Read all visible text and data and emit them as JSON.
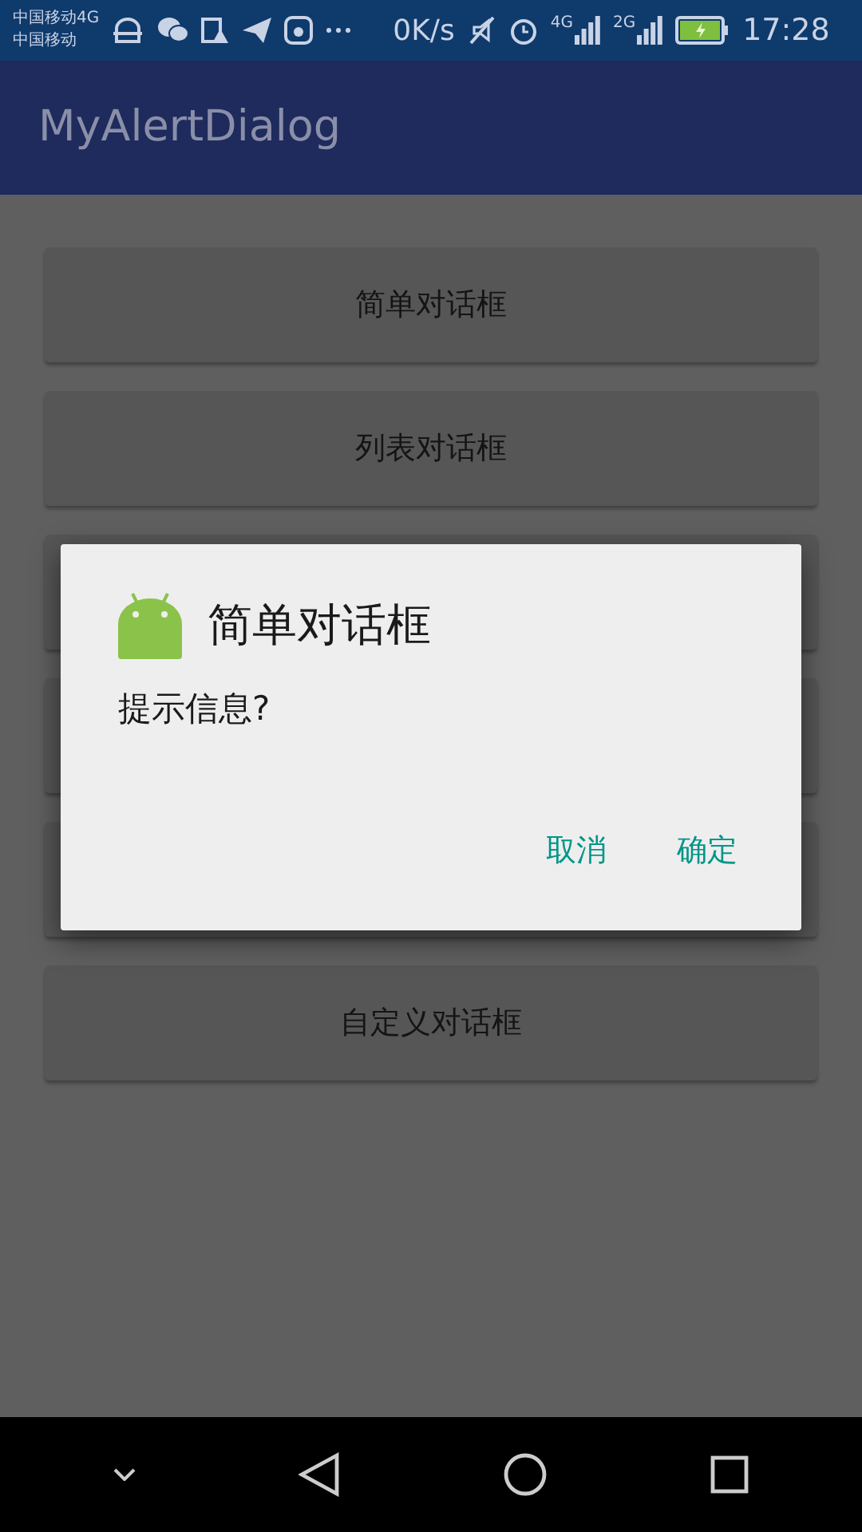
{
  "status_bar": {
    "carriers": [
      "中国移动4G",
      "中国移动"
    ],
    "speed": "0K/s",
    "signals": [
      "4G",
      "2G"
    ],
    "time": "17:28"
  },
  "app_bar": {
    "title": "MyAlertDialog"
  },
  "buttons": [
    {
      "kind": "labeled",
      "label": "简单对话框"
    },
    {
      "kind": "labeled",
      "label": "列表对话框"
    },
    {
      "kind": "covered"
    },
    {
      "kind": "covered"
    },
    {
      "kind": "covered"
    },
    {
      "kind": "labeled",
      "label": "自定义对话框"
    }
  ],
  "dialog": {
    "title": "简单对话框",
    "message": "提示信息?",
    "actions": [
      "取消",
      "确定"
    ]
  }
}
